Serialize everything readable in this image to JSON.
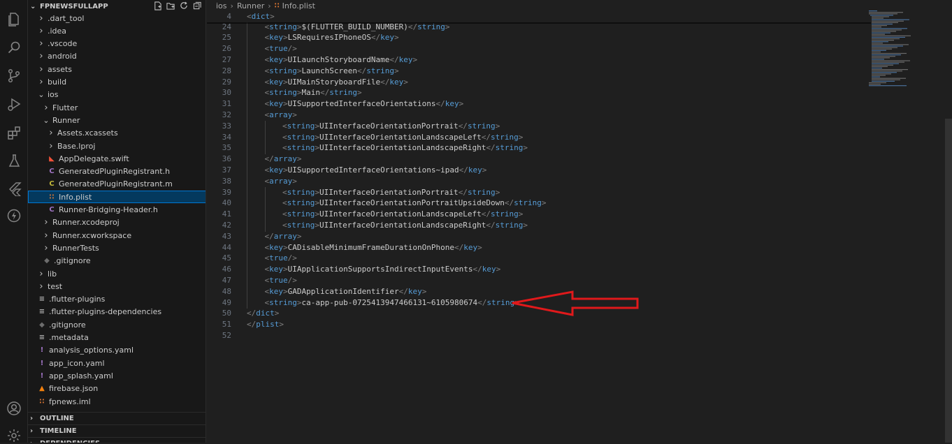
{
  "colors": {
    "tag": "#569cd6",
    "bracket": "#808080",
    "text": "#cccccc",
    "selection": "#04395e",
    "annotation_arrow": "#e0191b",
    "xml_rss_icon": "#e37933",
    "swift_icon": "#f05138",
    "c_icon": "#a074c4",
    "yaml_icon": "#a074c4",
    "firebase_icon": "#f5820d"
  },
  "activity_bar": {
    "items": [
      {
        "name": "explorer-icon"
      },
      {
        "name": "search-icon"
      },
      {
        "name": "source-control-icon"
      },
      {
        "name": "run-debug-icon"
      },
      {
        "name": "extensions-icon"
      },
      {
        "name": "testing-icon"
      },
      {
        "name": "flutter-icon"
      },
      {
        "name": "lightning-icon"
      }
    ],
    "bottom": [
      {
        "name": "account-icon"
      },
      {
        "name": "settings-gear-icon"
      }
    ]
  },
  "explorer": {
    "title": "FPNEWSFULLAPP",
    "actions": [
      "new-file-icon",
      "new-folder-icon",
      "refresh-icon",
      "collapse-all-icon"
    ],
    "tree": [
      {
        "label": ".dart_tool",
        "depth": 0,
        "type": "folder",
        "expanded": false
      },
      {
        "label": ".idea",
        "depth": 0,
        "type": "folder",
        "expanded": false
      },
      {
        "label": ".vscode",
        "depth": 0,
        "type": "folder",
        "expanded": false
      },
      {
        "label": "android",
        "depth": 0,
        "type": "folder",
        "expanded": false
      },
      {
        "label": "assets",
        "depth": 0,
        "type": "folder",
        "expanded": false
      },
      {
        "label": "build",
        "depth": 0,
        "type": "folder",
        "expanded": false
      },
      {
        "label": "ios",
        "depth": 0,
        "type": "folder",
        "expanded": true
      },
      {
        "label": "Flutter",
        "depth": 1,
        "type": "folder",
        "expanded": false
      },
      {
        "label": "Runner",
        "depth": 1,
        "type": "folder",
        "expanded": true
      },
      {
        "label": "Assets.xcassets",
        "depth": 2,
        "type": "folder",
        "expanded": false
      },
      {
        "label": "Base.lproj",
        "depth": 2,
        "type": "folder",
        "expanded": false
      },
      {
        "label": "AppDelegate.swift",
        "depth": 2,
        "type": "swift"
      },
      {
        "label": "GeneratedPluginRegistrant.h",
        "depth": 2,
        "type": "c"
      },
      {
        "label": "GeneratedPluginRegistrant.m",
        "depth": 2,
        "type": "m"
      },
      {
        "label": "Info.plist",
        "depth": 2,
        "type": "xml",
        "selected": true
      },
      {
        "label": "Runner-Bridging-Header.h",
        "depth": 2,
        "type": "c"
      },
      {
        "label": "Runner.xcodeproj",
        "depth": 1,
        "type": "folder",
        "expanded": false
      },
      {
        "label": "Runner.xcworkspace",
        "depth": 1,
        "type": "folder",
        "expanded": false
      },
      {
        "label": "RunnerTests",
        "depth": 1,
        "type": "folder",
        "expanded": false
      },
      {
        "label": ".gitignore",
        "depth": 1,
        "type": "git"
      },
      {
        "label": "lib",
        "depth": 0,
        "type": "folder",
        "expanded": false
      },
      {
        "label": "test",
        "depth": 0,
        "type": "folder",
        "expanded": false
      },
      {
        "label": ".flutter-plugins",
        "depth": 0,
        "type": "text"
      },
      {
        "label": ".flutter-plugins-dependencies",
        "depth": 0,
        "type": "text"
      },
      {
        "label": ".gitignore",
        "depth": 0,
        "type": "git"
      },
      {
        "label": ".metadata",
        "depth": 0,
        "type": "text"
      },
      {
        "label": "analysis_options.yaml",
        "depth": 0,
        "type": "yaml"
      },
      {
        "label": "app_icon.yaml",
        "depth": 0,
        "type": "yaml"
      },
      {
        "label": "app_splash.yaml",
        "depth": 0,
        "type": "yaml"
      },
      {
        "label": "firebase.json",
        "depth": 0,
        "type": "firebase"
      },
      {
        "label": "fpnews.iml",
        "depth": 0,
        "type": "xml"
      }
    ],
    "sections": [
      "OUTLINE",
      "TIMELINE",
      "DEPENDENCIES"
    ]
  },
  "breadcrumb": [
    "ios",
    "Runner",
    "Info.plist"
  ],
  "editor": {
    "sticky_line": {
      "num": "4",
      "text": "<dict>"
    },
    "lines": [
      {
        "num": "24",
        "indent": 1,
        "text": "<string>$(FLUTTER_BUILD_NUMBER)</string>"
      },
      {
        "num": "25",
        "indent": 1,
        "text": "<key>LSRequiresIPhoneOS</key>"
      },
      {
        "num": "26",
        "indent": 1,
        "text": "<true/>"
      },
      {
        "num": "27",
        "indent": 1,
        "text": "<key>UILaunchStoryboardName</key>"
      },
      {
        "num": "28",
        "indent": 1,
        "text": "<string>LaunchScreen</string>"
      },
      {
        "num": "29",
        "indent": 1,
        "text": "<key>UIMainStoryboardFile</key>"
      },
      {
        "num": "30",
        "indent": 1,
        "text": "<string>Main</string>"
      },
      {
        "num": "31",
        "indent": 1,
        "text": "<key>UISupportedInterfaceOrientations</key>"
      },
      {
        "num": "32",
        "indent": 1,
        "text": "<array>"
      },
      {
        "num": "33",
        "indent": 2,
        "text": "<string>UIInterfaceOrientationPortrait</string>"
      },
      {
        "num": "34",
        "indent": 2,
        "text": "<string>UIInterfaceOrientationLandscapeLeft</string>"
      },
      {
        "num": "35",
        "indent": 2,
        "text": "<string>UIInterfaceOrientationLandscapeRight</string>"
      },
      {
        "num": "36",
        "indent": 1,
        "text": "</array>"
      },
      {
        "num": "37",
        "indent": 1,
        "text": "<key>UISupportedInterfaceOrientations~ipad</key>"
      },
      {
        "num": "38",
        "indent": 1,
        "text": "<array>"
      },
      {
        "num": "39",
        "indent": 2,
        "text": "<string>UIInterfaceOrientationPortrait</string>"
      },
      {
        "num": "40",
        "indent": 2,
        "text": "<string>UIInterfaceOrientationPortraitUpsideDown</string>"
      },
      {
        "num": "41",
        "indent": 2,
        "text": "<string>UIInterfaceOrientationLandscapeLeft</string>"
      },
      {
        "num": "42",
        "indent": 2,
        "text": "<string>UIInterfaceOrientationLandscapeRight</string>"
      },
      {
        "num": "43",
        "indent": 1,
        "text": "</array>"
      },
      {
        "num": "44",
        "indent": 1,
        "text": "<key>CADisableMinimumFrameDurationOnPhone</key>"
      },
      {
        "num": "45",
        "indent": 1,
        "text": "<true/>"
      },
      {
        "num": "46",
        "indent": 1,
        "text": "<key>UIApplicationSupportsIndirectInputEvents</key>"
      },
      {
        "num": "47",
        "indent": 1,
        "text": "<true/>"
      },
      {
        "num": "48",
        "indent": 1,
        "text": "<key>GADApplicationIdentifier</key>"
      },
      {
        "num": "49",
        "indent": 1,
        "text": "<string>ca-app-pub-0725413947466131~6105980674</string>"
      },
      {
        "num": "50",
        "indent": 0,
        "text": "</dict>"
      },
      {
        "num": "51",
        "indent": 0,
        "text": "</plist>"
      },
      {
        "num": "52",
        "indent": 0,
        "text": ""
      }
    ]
  }
}
